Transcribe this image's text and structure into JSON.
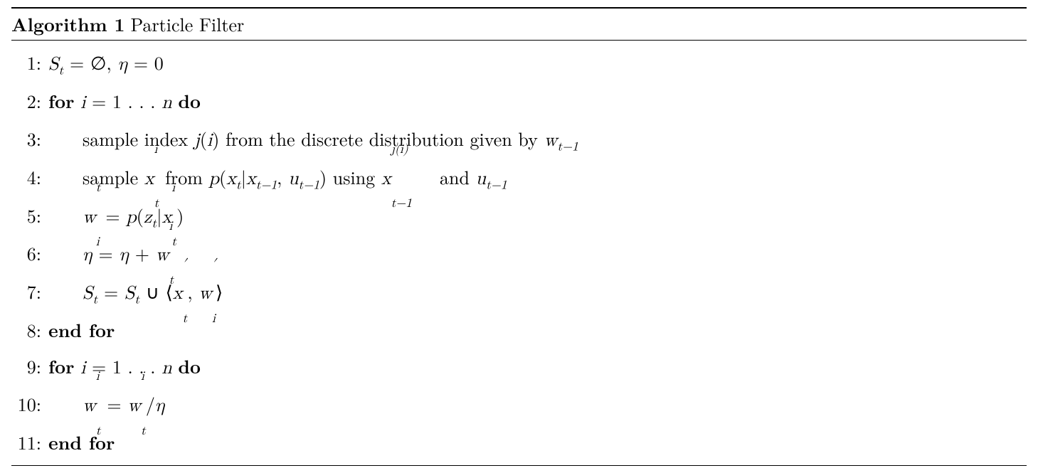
{
  "header": {
    "label": "Algorithm 1",
    "title": "Particle Filter"
  },
  "lines": [
    {
      "num": "1:",
      "text_html": "<span class='math'>S<sub>t</sub></span> = ∅, <span class='math'>η</span> = 0"
    },
    {
      "num": "2:",
      "text_html": "<span class='bf'>for</span> <span class='math'>i</span> = 1 . . . <span class='math'>n</span> <span class='bf'>do</span>"
    },
    {
      "num": "3:",
      "indent": 1,
      "text_html": "sample index <span class='math'>j</span>(<span class='math'>i</span>) from the discrete distribution given by <span class='math'>w<sub>t−1</sub></span>"
    },
    {
      "num": "4:",
      "indent": 1,
      "text_html": "sample <span class='math nobrk'>x<span class='subsup'><span class='spacer'>t</span><sup>i</sup><sub>t</sub></span></span> from <span class='math'>p</span>(<span class='math'>x<sub>t</sub></span>|<span class='math'>x<sub>t−1</sub></span>, <span class='math'>u<sub>t−1</sub></span>) using <span class='math nobrk'>x<span class='subsup'><span class='spacer'>t−1</span><sup>j(i)</sup><sub>t−1</sub></span></span>&nbsp;&nbsp;&nbsp;and <span class='math'>u<sub>t−1</sub></span>"
    },
    {
      "num": "5:",
      "indent": 1,
      "text_html": "<span class='math nobrk'>w<span class='subsup'><span class='spacer'>i</span><sup>t</sup><sub>i</sub></span></span> = <span class='math'>p</span>(<span class='math'>z<sub>t</sub></span>|<span class='math nobrk'>x<span class='subsup'><span class='spacer'>t</span><sup>i</sup><sub>t</sub></span></span>)"
    },
    {
      "num": "6:",
      "indent": 1,
      "text_html": "<span class='math'>η</span> = <span class='math'>η</span> + <span class='math nobrk'>w<span class='subsup'><span class='spacer'>t</span><sup>i</sup><sub>t</sub></span></span>"
    },
    {
      "num": "7:",
      "indent": 1,
      "text_html": "<span class='math'>S<sub>t</sub></span> = <span class='math'>S<sub>t</sub></span> ∪ ⟨<span class='math nobrk'>x<span class='subsup'><span class='spacer'>t</span><sup>′</sup><sub>t</sub></span></span>, <span class='math nobrk'>w<span class='subsup'><span class='spacer'>i</span><sup>′</sup><sub>i</sub></span></span>⟩"
    },
    {
      "num": "8:",
      "text_html": "<span class='bf'>end for</span>"
    },
    {
      "num": "9:",
      "text_html": "<span class='bf'>for</span> <span class='math'>i</span> = 1 . . . <span class='math'>n</span> <span class='bf'>do</span>"
    },
    {
      "num": "10:",
      "indent": 1,
      "text_html": "<span class='math nobrk'>w<span class='subsup'><span class='spacer'>t</span><sup>i</sup><sub>t</sub></span></span> = <span class='math nobrk'>w<span class='subsup'><span class='spacer'>t</span><sup>i</sup><sub>t</sub></span></span>/<span class='math'>η</span>"
    },
    {
      "num": "11:",
      "text_html": "<span class='bf'>end for</span>"
    }
  ]
}
